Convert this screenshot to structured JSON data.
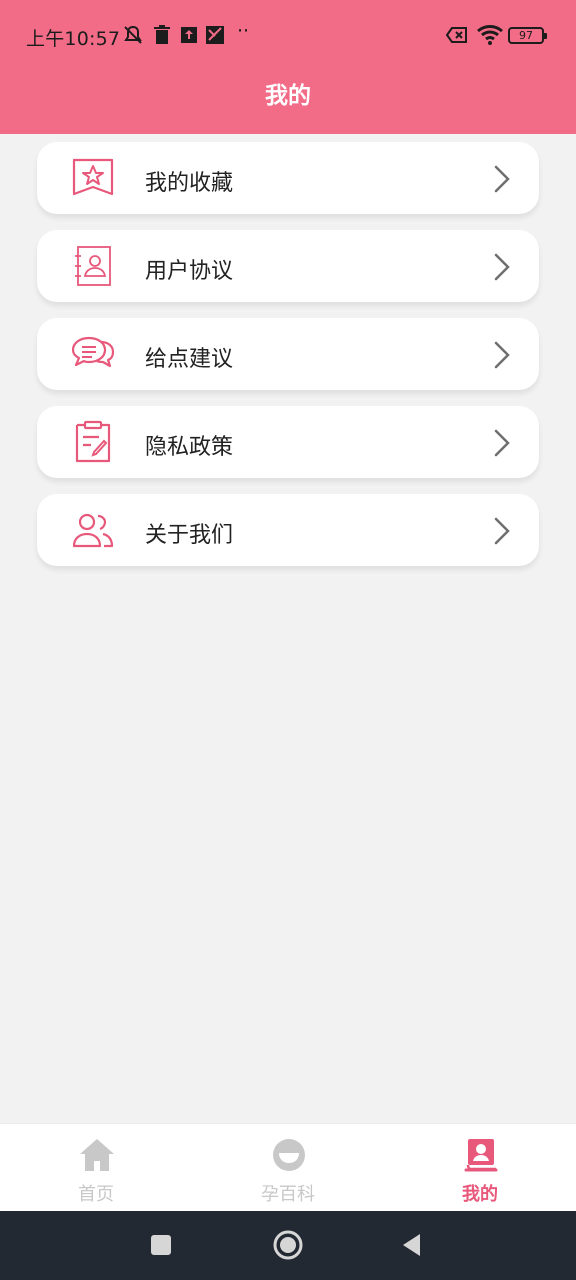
{
  "status_bar": {
    "time": "上午10:57",
    "dots": "··",
    "battery": "97"
  },
  "header": {
    "title": "我的"
  },
  "menu": [
    {
      "label": "我的收藏",
      "icon": "star-bookmark-icon"
    },
    {
      "label": "用户协议",
      "icon": "contact-book-icon"
    },
    {
      "label": "给点建议",
      "icon": "chat-bubbles-icon"
    },
    {
      "label": "隐私政策",
      "icon": "edit-document-icon"
    },
    {
      "label": "关于我们",
      "icon": "users-icon"
    }
  ],
  "tabbar": {
    "tabs": [
      {
        "label": "首页",
        "icon": "home-icon",
        "active": false
      },
      {
        "label": "孕百科",
        "icon": "encyclopedia-icon",
        "active": false
      },
      {
        "label": "我的",
        "icon": "profile-book-icon",
        "active": true
      }
    ]
  },
  "colors": {
    "header": "#f26b87",
    "accent": "#e7587b",
    "inactive": "#c8c8c8",
    "background": "#f2f2f2",
    "nav_bar": "#232933"
  }
}
